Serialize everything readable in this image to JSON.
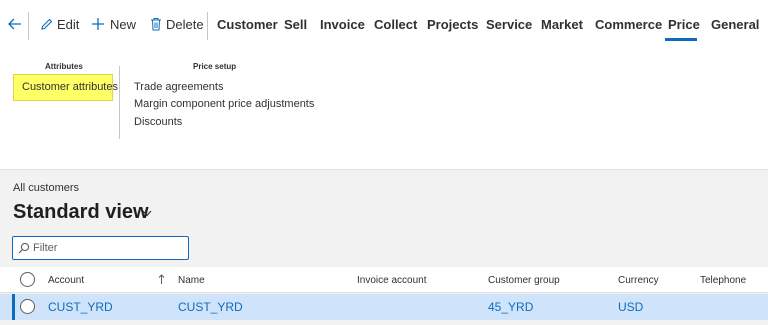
{
  "toolbar": {
    "edit": "Edit",
    "new": "New",
    "delete": "Delete",
    "tabs": [
      "Customer",
      "Sell",
      "Invoice",
      "Collect",
      "Projects",
      "Service",
      "Market",
      "Commerce",
      "Price",
      "General"
    ],
    "active_tab": "Price"
  },
  "ribbon": {
    "attributes": {
      "label": "Attributes",
      "items": [
        "Customer attributes"
      ]
    },
    "price_setup": {
      "label": "Price setup",
      "items": [
        "Trade agreements",
        "Margin component price adjustments",
        "Discounts"
      ]
    },
    "highlight_color": "#ffff66"
  },
  "page": {
    "breadcrumb": "All customers",
    "view_title": "Standard view"
  },
  "filter": {
    "placeholder": "Filter"
  },
  "grid": {
    "columns": [
      "Account",
      "Name",
      "Invoice account",
      "Customer group",
      "Currency",
      "Telephone"
    ],
    "rows": [
      {
        "account": "CUST_YRD",
        "name": "CUST_YRD",
        "invoice_account": "",
        "customer_group": "45_YRD",
        "currency": "USD",
        "telephone": ""
      }
    ]
  },
  "colors": {
    "accent": "#0f6cbd",
    "selected_row": "#cfe4fa"
  }
}
